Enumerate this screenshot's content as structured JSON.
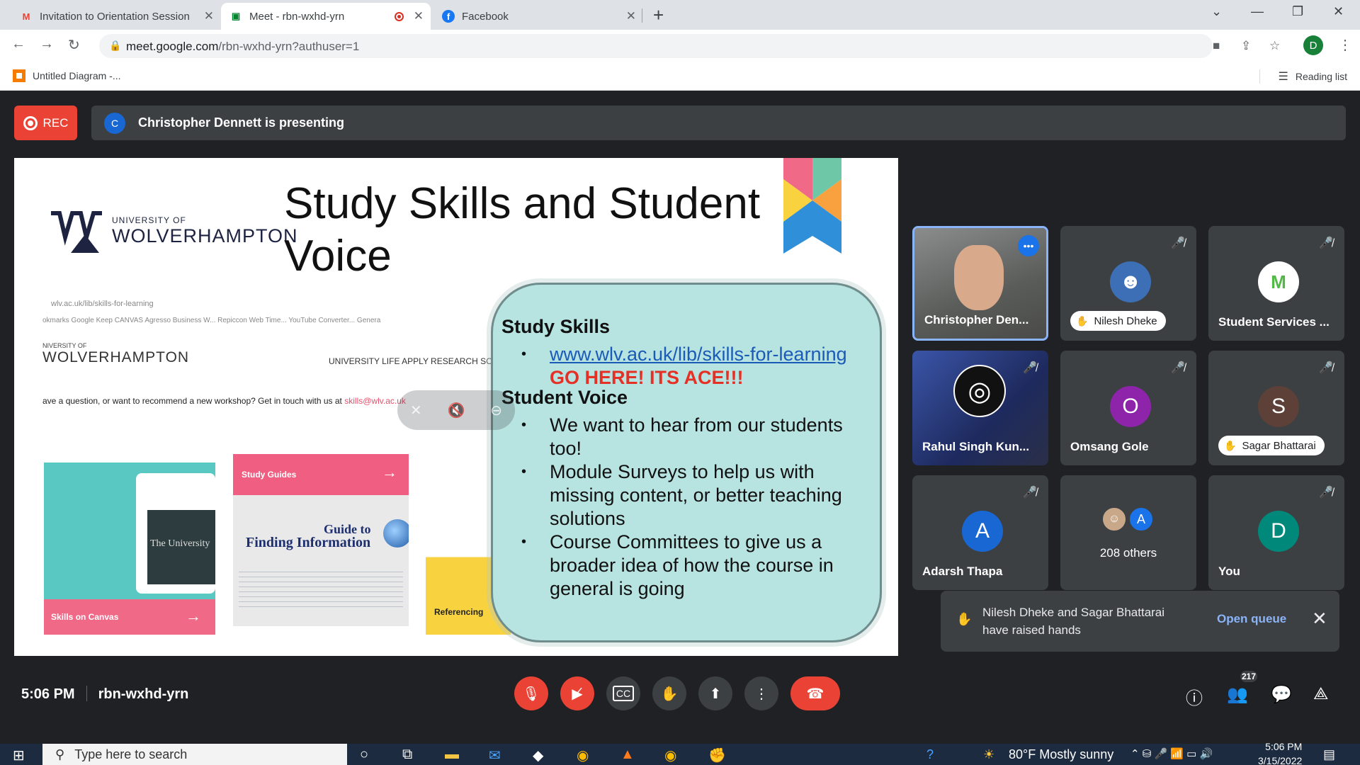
{
  "browser": {
    "tabs": [
      {
        "title": "Invitation to Orientation Session"
      },
      {
        "title": "Meet - rbn-wxhd-yrn"
      },
      {
        "title": "Facebook"
      }
    ],
    "url_host": "meet.google.com",
    "url_path": "/rbn-wxhd-yrn?authuser=1",
    "profile_initial": "D",
    "bookmark": "Untitled Diagram -...",
    "reading_list": "Reading list"
  },
  "meet": {
    "rec_label": "REC",
    "presenter_initial": "C",
    "presenting_text": "Christopher Dennett is presenting",
    "time": "5:06 PM",
    "meeting_code": "rbn-wxhd-yrn",
    "participant_count": "217"
  },
  "slide": {
    "university_small": "UNIVERSITY OF",
    "university_big": "WOLVERHAMPTON",
    "title": "Study Skills and Student Voice",
    "bg_url": "wlv.ac.uk/lib/skills-for-learning",
    "bg_bookmarks": "okmarks    Google Keep    CANVAS    Agresso Business W...    Repiccon Web Time...    YouTube Converter...    Genera",
    "bg_uni_small": "NIVERSITY OF",
    "bg_uni_big": "WOLVERHAMPTON",
    "bg_nav": "UNIVERSITY LIFE    APPLY    RESEARCH    SCH",
    "bg_question": "ave a question, or want to recommend a new workshop? Get in touch with us at",
    "bg_email": "skills@wlv.ac.uk",
    "card_canvas_label": "Skills on Canvas",
    "card_canvas_screen": "The University",
    "card_guides_label": "Study Guides",
    "card_guides_line1": "Guide to",
    "card_guides_line2": "Finding Information",
    "card_ref_label": "Referencing",
    "heading1": "Study Skills",
    "link": "www.wlv.ac.uk/lib/skills-for-learning",
    "go_here": "GO HERE! ITS ACE!!!",
    "heading2": "Student Voice",
    "bullets": [
      "We want to hear from our students too!",
      "Module Surveys to help us with missing content, or better teaching solutions",
      "Course Committees to give us a broader idea of how the course in general is going"
    ]
  },
  "tiles": [
    {
      "name": "Christopher Den..."
    },
    {
      "name": "Nilesh Dheke"
    },
    {
      "name": "Student Services ..."
    },
    {
      "name": "Rahul Singh Kun..."
    },
    {
      "name": "Omsang Gole",
      "initial": "O"
    },
    {
      "name": "Sagar Bhattarai",
      "initial": "S"
    },
    {
      "name": "Adarsh Thapa",
      "initial": "A"
    },
    {
      "name": "208 others",
      "initial": "A"
    },
    {
      "name": "You",
      "initial": "D"
    }
  ],
  "toast": {
    "message": "Nilesh Dheke and Sagar Bhattarai have raised hands",
    "action": "Open queue"
  },
  "taskbar": {
    "search_placeholder": "Type here to search",
    "weather": "80°F  Mostly sunny",
    "time": "5:06 PM",
    "date": "3/15/2022"
  },
  "colors": {
    "meet_bg": "#202124",
    "tile_bg": "#3c4043",
    "red": "#ea4335",
    "blue_link": "#8ab4f8"
  }
}
